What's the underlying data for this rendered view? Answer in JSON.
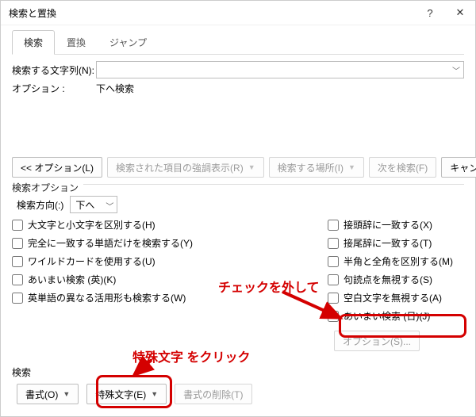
{
  "window": {
    "title": "検索と置換",
    "help_icon": "?",
    "close_icon": "✕"
  },
  "tabs": {
    "search": "検索",
    "replace": "置換",
    "jump": "ジャンプ"
  },
  "fields": {
    "find_label": "検索する文字列(N):",
    "find_value": "",
    "options_label": "オプション :",
    "options_value": "下へ検索"
  },
  "button_bar": {
    "options": "<< オプション(L)",
    "highlight": "検索された項目の強調表示(R)",
    "find_in": "検索する場所(I)",
    "find_next": "次を検索(F)",
    "cancel": "キャンセル"
  },
  "search_options": {
    "title": "検索オプション",
    "direction_label": "検索方向(:)",
    "direction_value": "下へ",
    "left": {
      "match_case": "大文字と小文字を区別する(H)",
      "whole_word": "完全に一致する単語だけを検索する(Y)",
      "wildcards": "ワイルドカードを使用する(U)",
      "sounds_en": "あいまい検索 (英)(K)",
      "word_forms": "英単語の異なる活用形も検索する(W)"
    },
    "right": {
      "prefix": "接頭辞に一致する(X)",
      "suffix": "接尾辞に一致する(T)",
      "width": "半角と全角を区別する(M)",
      "punct": "句読点を無視する(S)",
      "whitespace": "空白文字を無視する(A)",
      "sounds_ja": "あいまい検索 (日)(J)",
      "options_btn": "オプション(S)..."
    }
  },
  "footer": {
    "section": "検索",
    "format": "書式(O)",
    "special": "特殊文字(E)",
    "no_format": "書式の削除(T)"
  },
  "annotations": {
    "uncheck": "チェックを外して",
    "click_special": "特殊文字 をクリック"
  }
}
